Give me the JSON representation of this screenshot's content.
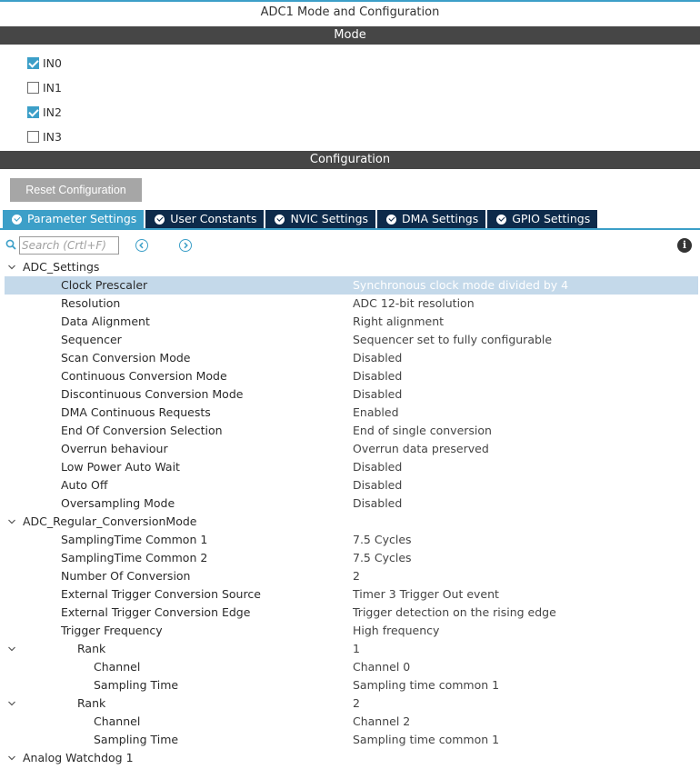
{
  "window": {
    "title": "ADC1 Mode and Configuration"
  },
  "mode": {
    "header": "Mode",
    "items": [
      {
        "label": "IN0",
        "checked": true
      },
      {
        "label": "IN1",
        "checked": false
      },
      {
        "label": "IN2",
        "checked": true
      },
      {
        "label": "IN3",
        "checked": false
      }
    ]
  },
  "configuration": {
    "header": "Configuration",
    "reset_label": "Reset Configuration",
    "tabs": [
      {
        "label": "Parameter Settings",
        "active": true
      },
      {
        "label": "User Constants",
        "active": false
      },
      {
        "label": "NVIC Settings",
        "active": false
      },
      {
        "label": "DMA Settings",
        "active": false
      },
      {
        "label": "GPIO Settings",
        "active": false
      }
    ],
    "search": {
      "placeholder": "Search (Crtl+F)"
    },
    "tree": {
      "adc_settings": {
        "label": "ADC_Settings",
        "rows": [
          {
            "label": "Clock Prescaler",
            "value": "Synchronous clock mode divided by 4"
          },
          {
            "label": "Resolution",
            "value": "ADC 12-bit resolution"
          },
          {
            "label": "Data Alignment",
            "value": "Right alignment"
          },
          {
            "label": "Sequencer",
            "value": "Sequencer set to fully configurable"
          },
          {
            "label": "Scan Conversion Mode",
            "value": "Disabled"
          },
          {
            "label": "Continuous Conversion Mode",
            "value": "Disabled"
          },
          {
            "label": "Discontinuous Conversion Mode",
            "value": "Disabled"
          },
          {
            "label": "DMA Continuous Requests",
            "value": "Enabled"
          },
          {
            "label": "End Of Conversion Selection",
            "value": "End of single conversion"
          },
          {
            "label": "Overrun behaviour",
            "value": "Overrun data preserved"
          },
          {
            "label": "Low Power Auto Wait",
            "value": "Disabled"
          },
          {
            "label": "Auto Off",
            "value": "Disabled"
          },
          {
            "label": "Oversampling Mode",
            "value": "Disabled"
          }
        ]
      },
      "regular": {
        "label": "ADC_Regular_ConversionMode",
        "rows": [
          {
            "label": "SamplingTime Common 1",
            "value": "7.5 Cycles"
          },
          {
            "label": "SamplingTime Common 2",
            "value": "7.5 Cycles"
          },
          {
            "label": "Number Of Conversion",
            "value": "2"
          },
          {
            "label": "External Trigger Conversion Source",
            "value": "Timer 3 Trigger Out event"
          },
          {
            "label": "External Trigger Conversion Edge",
            "value": "Trigger detection on the rising edge"
          },
          {
            "label": "Trigger Frequency",
            "value": "High frequency"
          }
        ],
        "ranks": [
          {
            "label": "Rank",
            "value": "1",
            "channel_label": "Channel",
            "channel_value": "Channel 0",
            "sampling_label": "Sampling Time",
            "sampling_value": "Sampling time common 1"
          },
          {
            "label": "Rank",
            "value": "2",
            "channel_label": "Channel",
            "channel_value": "Channel 2",
            "sampling_label": "Sampling Time",
            "sampling_value": "Sampling time common 1"
          }
        ]
      },
      "watchdog": {
        "label": "Analog Watchdog 1"
      }
    }
  },
  "colors": {
    "accent": "#3c9fc8",
    "tab_dark": "#0d2a4a",
    "section_bar": "#464646",
    "selected_row": "#c4d9ea"
  }
}
